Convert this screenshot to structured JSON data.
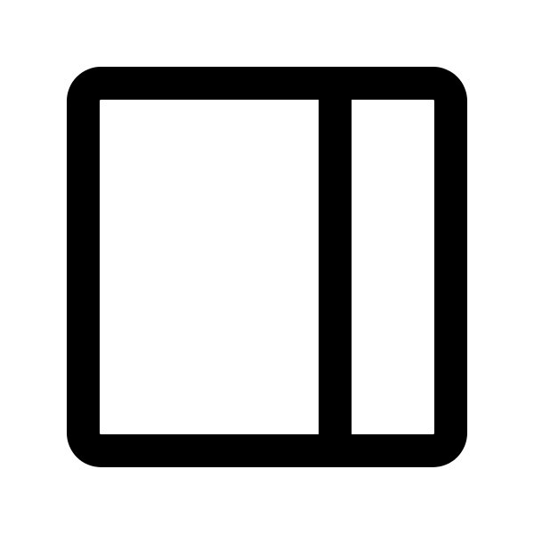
{
  "icon": {
    "name": "sidebar-right-icon",
    "stroke_color": "#000000",
    "background_color": "#ffffff"
  }
}
